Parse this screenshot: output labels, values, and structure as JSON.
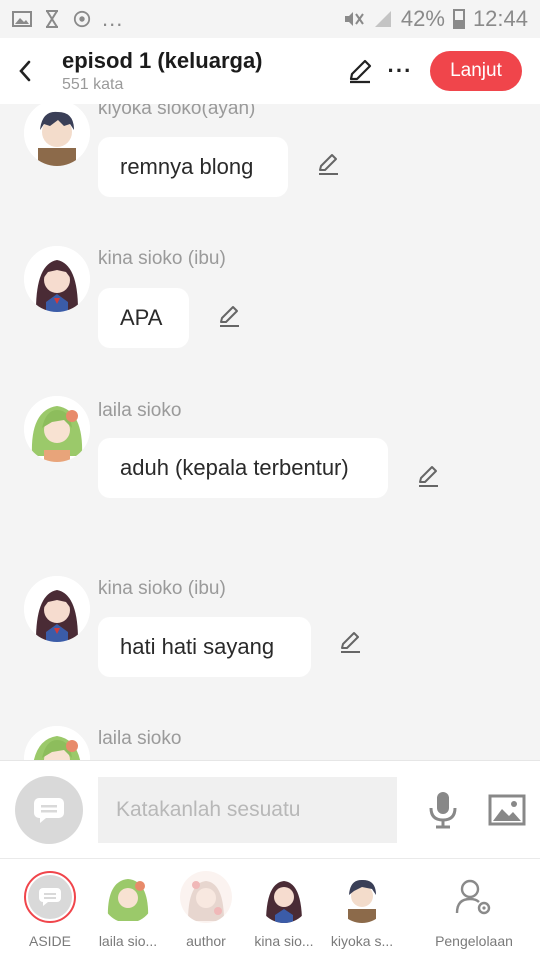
{
  "status": {
    "icons": [
      "gallery-icon",
      "hourglass-icon",
      "chrome-icon"
    ],
    "more": "...",
    "battery": "42%",
    "time": "12:44"
  },
  "header": {
    "title": "episod 1 (keluarga)",
    "word_count": "551 kata",
    "next_label": "Lanjut",
    "more_label": "···"
  },
  "messages": [
    {
      "speaker": "kiyoka sioko(ayah)",
      "text": "remnya blong",
      "avatar": "male"
    },
    {
      "speaker": "kina sioko (ibu)",
      "text": "APA",
      "avatar": "female"
    },
    {
      "speaker": "laila sioko",
      "text": "aduh (kepala terbentur)",
      "avatar": "green"
    },
    {
      "speaker": "kina sioko (ibu)",
      "text": "hati hati sayang",
      "avatar": "female"
    },
    {
      "speaker": "laila sioko",
      "text": "",
      "avatar": "green"
    }
  ],
  "input": {
    "placeholder": "Katakanlah sesuatu"
  },
  "characters": [
    {
      "label": "ASIDE"
    },
    {
      "label": "laila sio..."
    },
    {
      "label": "author"
    },
    {
      "label": "kina sio..."
    },
    {
      "label": "kiyoka s..."
    },
    {
      "label": "Pengelolaan"
    }
  ],
  "colors": {
    "accent": "#f0454b",
    "background": "#f4f4f4"
  }
}
